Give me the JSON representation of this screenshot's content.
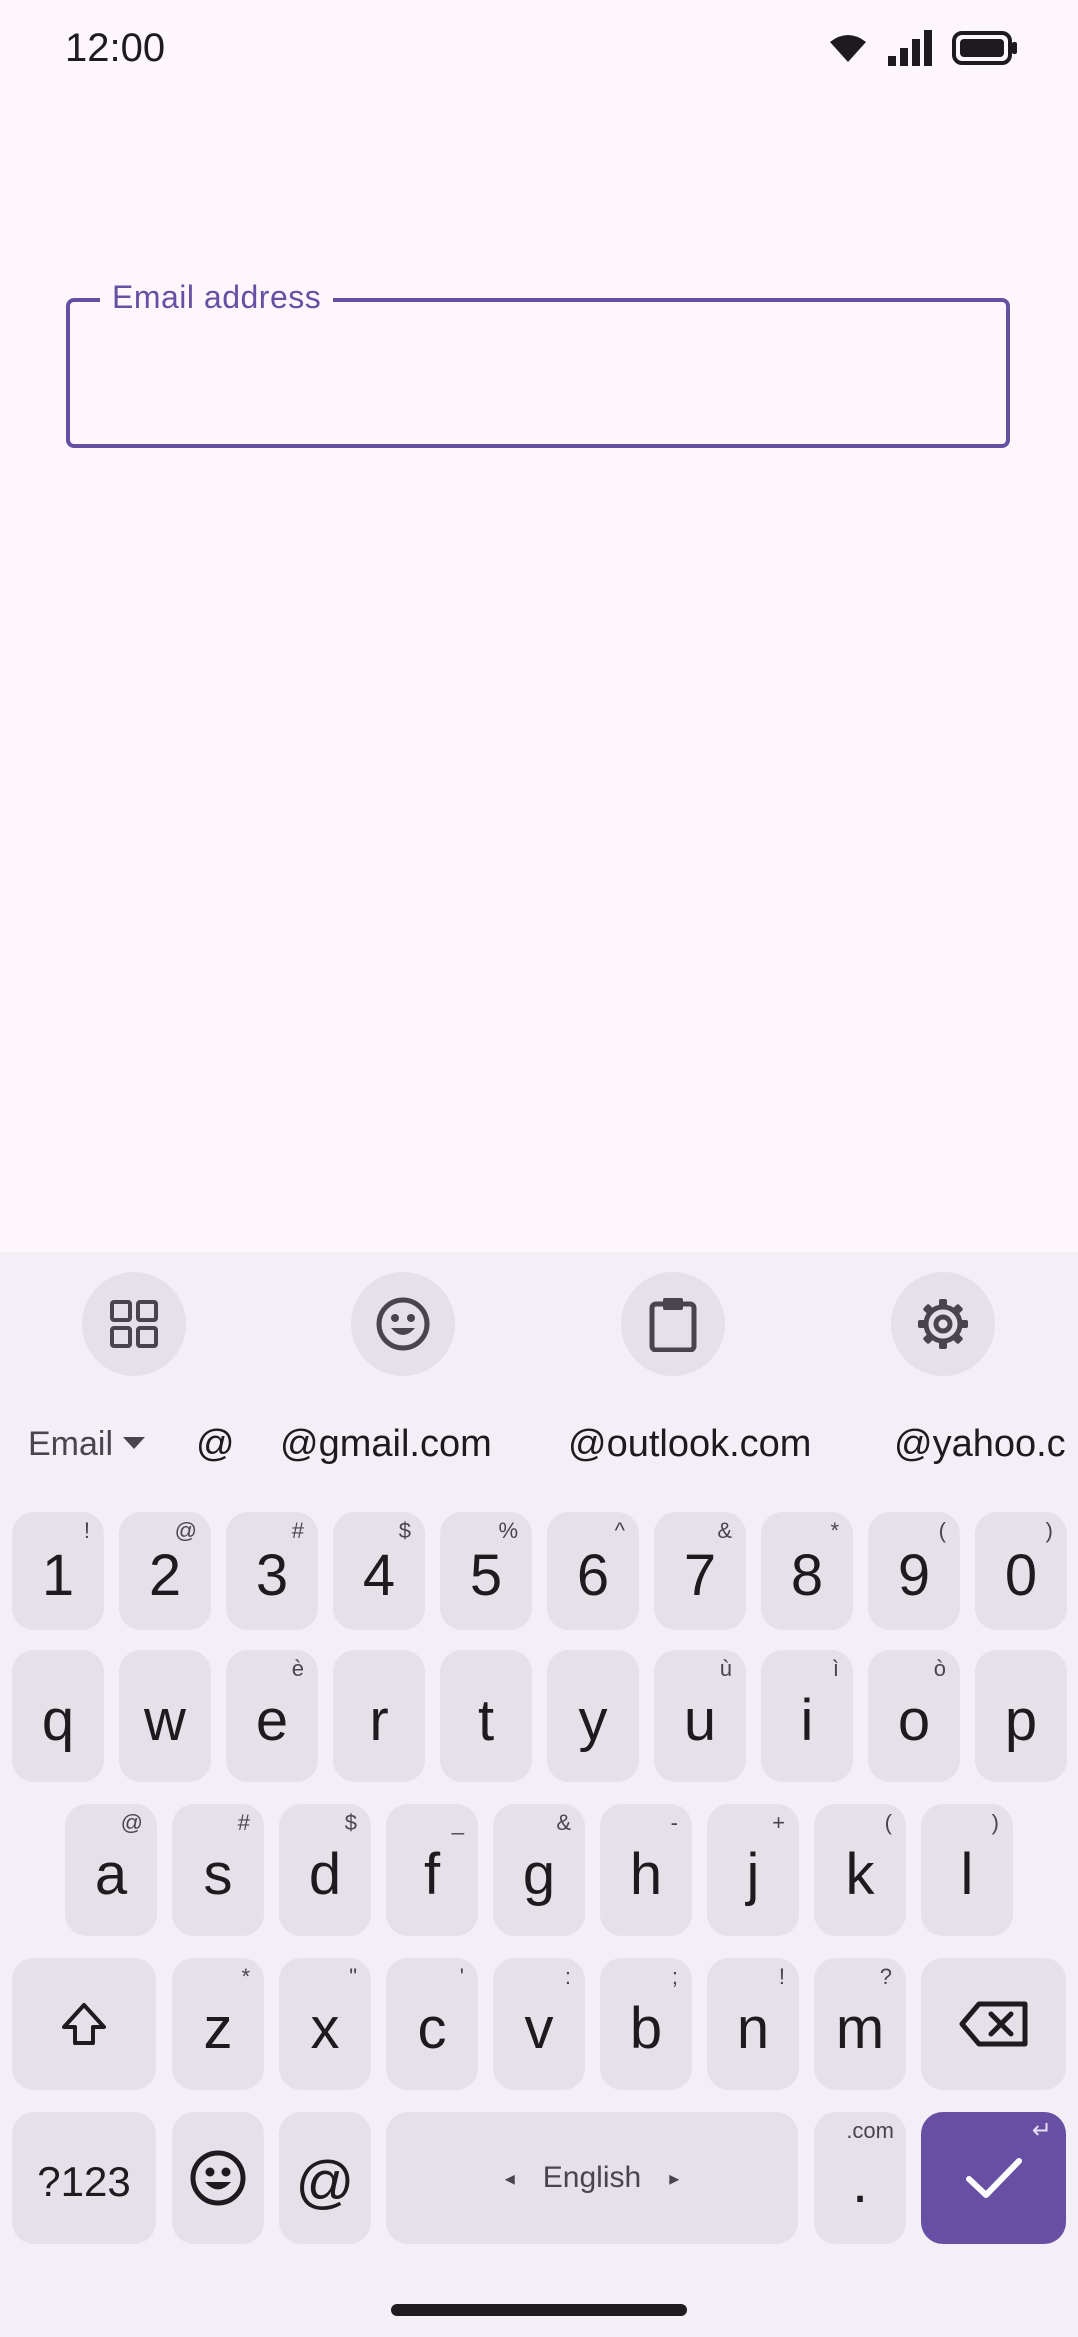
{
  "status": {
    "time": "12:00"
  },
  "field": {
    "label": "Email address",
    "value": ""
  },
  "keyboard": {
    "mode_label": "Email",
    "suggestions": [
      "@",
      "@gmail.com",
      "@outlook.com",
      "@yahoo.c"
    ],
    "number_row": [
      {
        "k": "1",
        "h": "!"
      },
      {
        "k": "2",
        "h": "@"
      },
      {
        "k": "3",
        "h": "#"
      },
      {
        "k": "4",
        "h": "$"
      },
      {
        "k": "5",
        "h": "%"
      },
      {
        "k": "6",
        "h": "^"
      },
      {
        "k": "7",
        "h": "&"
      },
      {
        "k": "8",
        "h": "*"
      },
      {
        "k": "9",
        "h": "("
      },
      {
        "k": "0",
        "h": ")"
      }
    ],
    "row1": [
      {
        "k": "q",
        "h": ""
      },
      {
        "k": "w",
        "h": ""
      },
      {
        "k": "e",
        "h": "è"
      },
      {
        "k": "r",
        "h": ""
      },
      {
        "k": "t",
        "h": ""
      },
      {
        "k": "y",
        "h": ""
      },
      {
        "k": "u",
        "h": "ù"
      },
      {
        "k": "i",
        "h": "ì"
      },
      {
        "k": "o",
        "h": "ò"
      },
      {
        "k": "p",
        "h": ""
      }
    ],
    "row2": [
      {
        "k": "a",
        "h": "@"
      },
      {
        "k": "s",
        "h": "#"
      },
      {
        "k": "d",
        "h": "$"
      },
      {
        "k": "f",
        "h": "_"
      },
      {
        "k": "g",
        "h": "&"
      },
      {
        "k": "h",
        "h": "-"
      },
      {
        "k": "j",
        "h": "+"
      },
      {
        "k": "k",
        "h": "("
      },
      {
        "k": "l",
        "h": ")"
      }
    ],
    "row3": [
      {
        "k": "z",
        "h": "*"
      },
      {
        "k": "x",
        "h": "\""
      },
      {
        "k": "c",
        "h": "'"
      },
      {
        "k": "v",
        "h": ":"
      },
      {
        "k": "b",
        "h": ";"
      },
      {
        "k": "n",
        "h": "!"
      },
      {
        "k": "m",
        "h": "?"
      }
    ],
    "symbols_label": "?123",
    "at_label": "@",
    "space_label": "English",
    "space_left": "◂",
    "space_right": "▸",
    "period_label": ".",
    "period_hint": ".com",
    "enter_hint": "↵"
  },
  "colors": {
    "accent": "#6750a4",
    "background": "#fdf7fc",
    "key": "#e6e0e9",
    "keyboard_bg": "#f4eff6"
  }
}
